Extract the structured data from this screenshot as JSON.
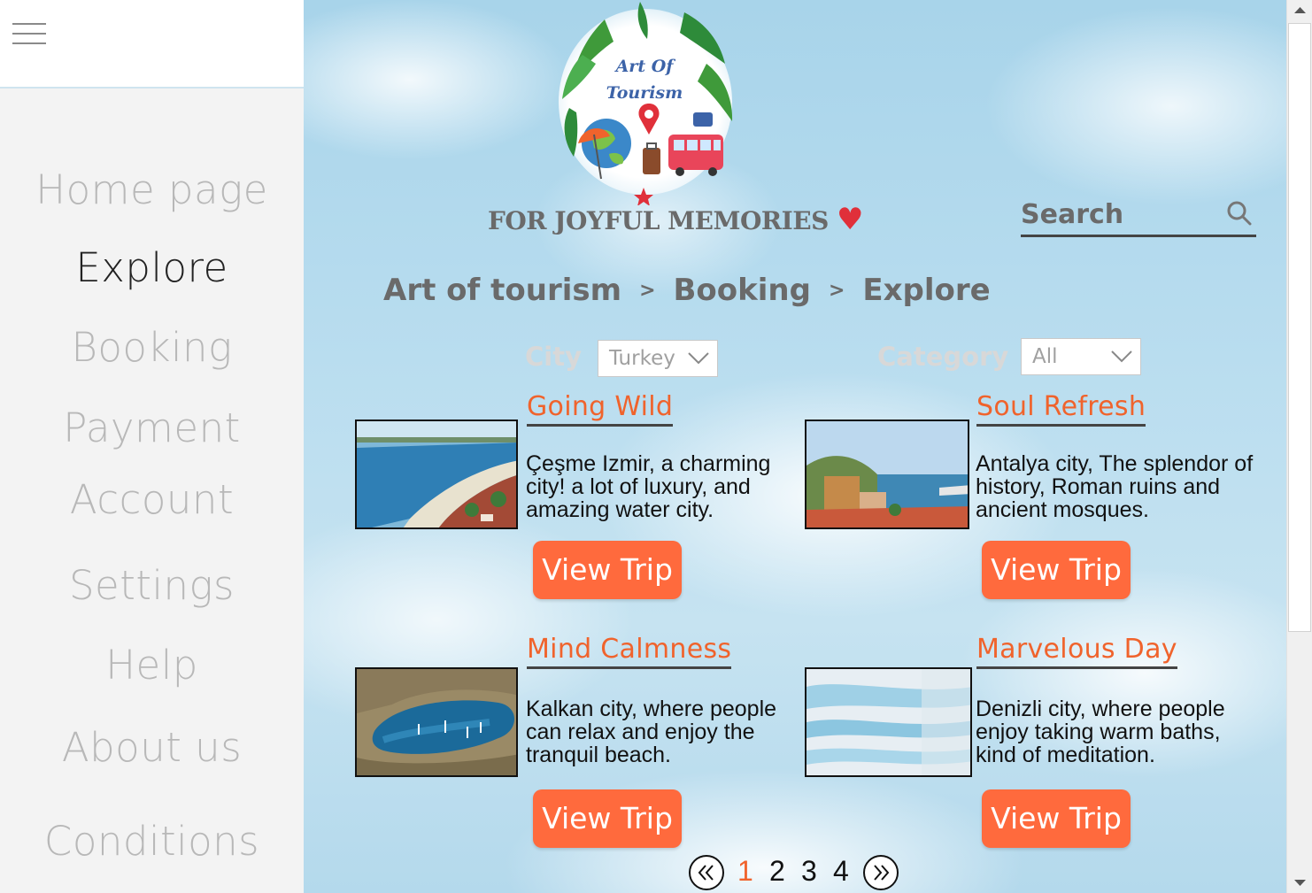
{
  "sidebar": {
    "items": [
      {
        "label": "Home page"
      },
      {
        "label": "Explore"
      },
      {
        "label": "Booking"
      },
      {
        "label": "Payment"
      },
      {
        "label": "Account"
      },
      {
        "label": "Settings"
      },
      {
        "label": "Help"
      },
      {
        "label": "About us"
      },
      {
        "label": "Conditions"
      }
    ],
    "active": "Explore"
  },
  "logo": {
    "line1": "Art Of",
    "line2": "Tourism"
  },
  "tagline": {
    "text": "FOR JOYFUL MEMORIES",
    "heart": "♥"
  },
  "search": {
    "placeholder": "Search"
  },
  "breadcrumb": {
    "items": [
      "Art of tourism",
      "Booking",
      "Explore"
    ],
    "separator": ">"
  },
  "filters": {
    "city": {
      "label": "City",
      "value": "Turkey"
    },
    "category": {
      "label": "Category",
      "value": "All"
    }
  },
  "cards": [
    {
      "title": "Going Wild",
      "description": "Çeşme Izmir, a charming city! a lot of luxury, and amazing water city.",
      "button": "View Trip"
    },
    {
      "title": "Soul Refresh",
      "description": "Antalya city, The splendor of history, Roman ruins and ancient mosques.",
      "button": "View Trip"
    },
    {
      "title": "Mind Calmness",
      "description": "Kalkan city, where people can relax and enjoy the tranquil beach.",
      "button": "View Trip"
    },
    {
      "title": "Marvelous Day",
      "description": "Denizli city, where people enjoy taking warm baths, kind of meditation.",
      "button": "View Trip"
    }
  ],
  "pagination": {
    "pages": [
      "1",
      "2",
      "3",
      "4"
    ],
    "current": "1"
  },
  "colors": {
    "accent": "#f0632c",
    "button": "#ff6a3d",
    "heart": "#e0303a",
    "logo_text": "#3c63a8"
  }
}
